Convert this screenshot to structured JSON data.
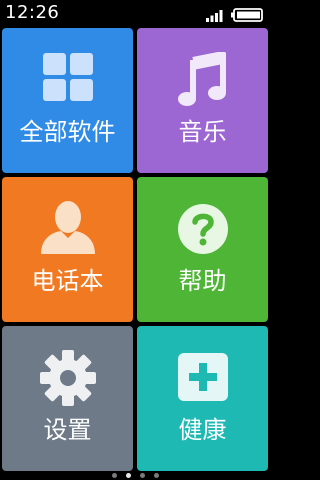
{
  "status_bar": {
    "time": "12:26",
    "signal_icon": "signal-bars-icon",
    "battery_icon": "battery-icon"
  },
  "tiles": [
    {
      "id": "apps",
      "label": "全部软件",
      "color": "#2F8BE6",
      "icon": "grid-icon"
    },
    {
      "id": "music",
      "label": "音乐",
      "color": "#9C67D2",
      "icon": "music-note-icon"
    },
    {
      "id": "phone",
      "label": "电话本",
      "color": "#F07921",
      "icon": "contact-person-icon"
    },
    {
      "id": "help",
      "label": "帮助",
      "color": "#4FB536",
      "icon": "question-mark-icon"
    },
    {
      "id": "settings",
      "label": "设置",
      "color": "#6E7A88",
      "icon": "gear-icon"
    },
    {
      "id": "health",
      "label": "健康",
      "color": "#1FB9B4",
      "icon": "medical-plus-icon"
    }
  ],
  "page_indicator": {
    "pages": 4,
    "active": 2
  }
}
